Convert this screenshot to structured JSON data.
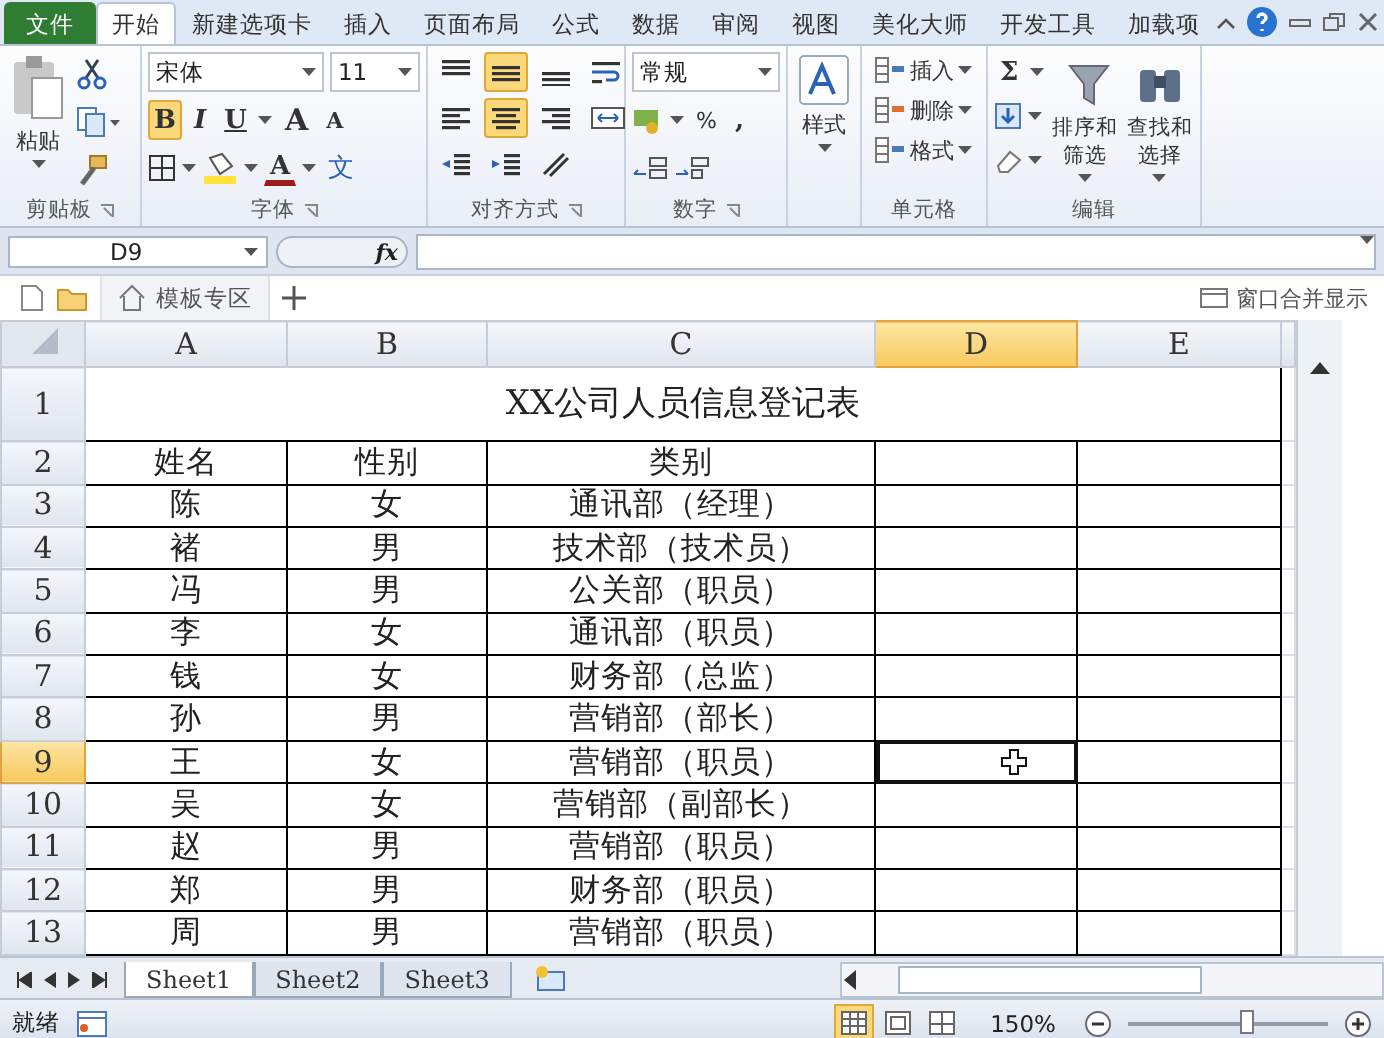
{
  "menu_tabs": [
    {
      "label": "文件",
      "kind": "file",
      "selected": false
    },
    {
      "label": "开始",
      "kind": "tab",
      "selected": true
    },
    {
      "label": "新建选项卡",
      "kind": "tab",
      "selected": false
    },
    {
      "label": "插入",
      "kind": "tab",
      "selected": false
    },
    {
      "label": "页面布局",
      "kind": "tab",
      "selected": false
    },
    {
      "label": "公式",
      "kind": "tab",
      "selected": false
    },
    {
      "label": "数据",
      "kind": "tab",
      "selected": false
    },
    {
      "label": "审阅",
      "kind": "tab",
      "selected": false
    },
    {
      "label": "视图",
      "kind": "tab",
      "selected": false
    },
    {
      "label": "美化大师",
      "kind": "tab",
      "selected": false
    },
    {
      "label": "开发工具",
      "kind": "tab",
      "selected": false
    },
    {
      "label": "加载项",
      "kind": "tab",
      "selected": false
    }
  ],
  "ribbon": {
    "clipboard": {
      "paste": "粘贴",
      "label": "剪贴板"
    },
    "font": {
      "name": "宋体",
      "size": "11",
      "label": "字体",
      "styles": [
        {
          "label": "B",
          "kind": "bold",
          "selected": true
        },
        {
          "label": "I",
          "kind": "italic",
          "selected": false
        },
        {
          "label": "U",
          "kind": "underline",
          "selected": false
        }
      ],
      "grow": "A",
      "shrink": "A",
      "color_button": "A",
      "phonetic": "文"
    },
    "alignment": {
      "label": "对齐方式",
      "buttons": [
        {
          "kind": "top",
          "selected": false
        },
        {
          "kind": "middle",
          "selected": true
        },
        {
          "kind": "bottom",
          "selected": false
        },
        {
          "kind": "wrap",
          "selected": false
        },
        {
          "kind": "left",
          "selected": false
        },
        {
          "kind": "center",
          "selected": true
        },
        {
          "kind": "right",
          "selected": false
        },
        {
          "kind": "merge",
          "selected": false
        },
        {
          "kind": "outdent",
          "selected": false
        },
        {
          "kind": "indent",
          "selected": false
        },
        {
          "kind": "orient",
          "selected": false
        }
      ]
    },
    "number": {
      "format": "常规",
      "percent": "%",
      "comma": ",",
      "label": "数字"
    },
    "styles": {
      "button": "样式"
    },
    "cells": {
      "buttons": [
        "插入",
        "删除",
        "格式"
      ],
      "label": "单元格"
    },
    "editing": {
      "sum": "Σ",
      "buttons": [
        "排序和筛选",
        "查找和选择"
      ],
      "label": "编辑"
    }
  },
  "name_box": "D9",
  "fx": "fx",
  "doc_tabs": {
    "tab": "模板专区",
    "merge": "窗口合并显示"
  },
  "sheet": {
    "columns": [
      {
        "label": "A",
        "selected": false
      },
      {
        "label": "B",
        "selected": false
      },
      {
        "label": "C",
        "selected": false
      },
      {
        "label": "D",
        "selected": true
      },
      {
        "label": "E",
        "selected": false
      }
    ],
    "title_row": {
      "label": "1",
      "selected": false,
      "title": "XX公司人员信息登记表"
    },
    "rows": [
      {
        "label": "2",
        "selected": false,
        "cells": [
          "姓名",
          "性别",
          "类别"
        ]
      },
      {
        "label": "3",
        "selected": false,
        "cells": [
          "陈",
          "女",
          "通讯部（经理）"
        ]
      },
      {
        "label": "4",
        "selected": false,
        "cells": [
          "褚",
          "男",
          "技术部（技术员）"
        ]
      },
      {
        "label": "5",
        "selected": false,
        "cells": [
          "冯",
          "男",
          "公关部（职员）"
        ]
      },
      {
        "label": "6",
        "selected": false,
        "cells": [
          "李",
          "女",
          "通讯部（职员）"
        ]
      },
      {
        "label": "7",
        "selected": false,
        "cells": [
          "钱",
          "女",
          "财务部（总监）"
        ]
      },
      {
        "label": "8",
        "selected": false,
        "cells": [
          "孙",
          "男",
          "营销部（部长）"
        ]
      },
      {
        "label": "9",
        "selected": true,
        "cells": [
          "王",
          "女",
          "营销部（职员）"
        ]
      },
      {
        "label": "10",
        "selected": false,
        "cells": [
          "吴",
          "女",
          "营销部（副部长）"
        ]
      },
      {
        "label": "11",
        "selected": false,
        "cells": [
          "赵",
          "男",
          "营销部（职员）"
        ]
      },
      {
        "label": "12",
        "selected": false,
        "cells": [
          "郑",
          "男",
          "财务部（职员）"
        ]
      },
      {
        "label": "13",
        "selected": false,
        "cells": [
          "周",
          "男",
          "营销部（职员）"
        ]
      }
    ]
  },
  "sheet_tabs": [
    {
      "label": "Sheet1",
      "selected": true
    },
    {
      "label": "Sheet2",
      "selected": false
    },
    {
      "label": "Sheet3",
      "selected": false
    }
  ],
  "status_bar": {
    "status": "就绪",
    "views": [
      {
        "kind": "normal",
        "selected": true
      },
      {
        "kind": "layout",
        "selected": false
      },
      {
        "kind": "break",
        "selected": false
      }
    ],
    "zoom": "150%",
    "zoom_slider": {
      "level": 0.6
    }
  }
}
